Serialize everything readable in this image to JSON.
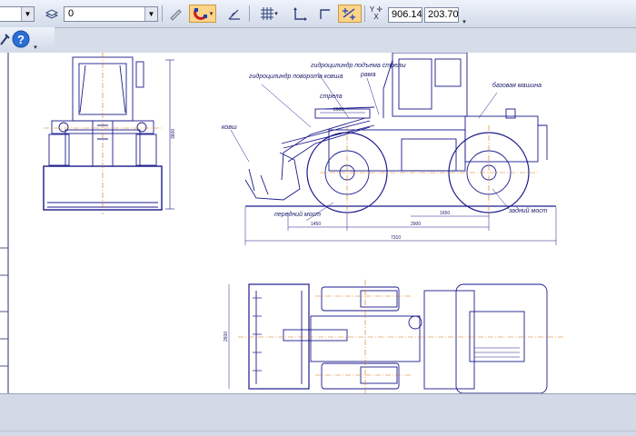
{
  "toolbar": {
    "layer_value": "0",
    "coord_y_label": "Y",
    "coord_x_label": "X",
    "coord_x_value": "906.146",
    "coord_y_value": "203.70"
  },
  "drawing": {
    "labels": {
      "rotation_cylinder": "гидроцилиндр поворота ковша",
      "lift_cylinder": "гидроцилиндр подъема стрелы",
      "frame": "рама",
      "base_machine": "базовая машина",
      "boom": "стрела",
      "bucket": "ковш",
      "front_axle": "передний мост",
      "rear_axle": "задний мост"
    },
    "dimensions": {
      "overall_length": "7310",
      "wheelbase": "2900",
      "rear_overhang": "1650",
      "front_overhang": "1450",
      "height": "3600",
      "width_front": "2600",
      "width_top": "2600"
    }
  },
  "colors": {
    "line": "#1a1a8c",
    "axis": "#d4720a",
    "background": "#ffffff",
    "toolbar": "#dfe5f0"
  }
}
